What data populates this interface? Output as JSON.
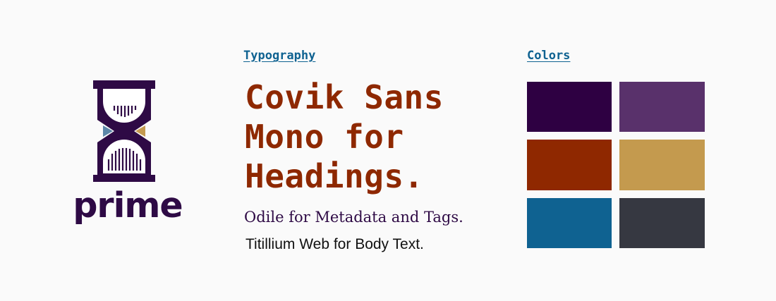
{
  "logo": {
    "wordmark": "prime",
    "colors": {
      "frame": "#2e0a45",
      "glass": "#ffffff",
      "left_accent": "#5c87a8",
      "right_accent": "#c49a50"
    }
  },
  "typography": {
    "title": "Typography",
    "title_color": "#0f6291",
    "heading_lines": [
      "Covik Sans",
      "Mono for",
      "Headings."
    ],
    "heading_color": "#8e2800",
    "metadata": "Odile for Metadata and Tags.",
    "metadata_color": "#2e0a45",
    "body": "Titillium Web for Body Text.",
    "body_color": "#111111"
  },
  "colors": {
    "title": "Colors",
    "title_color": "#0f6291",
    "swatches": [
      "#2e0042",
      "#59316b",
      "#8f2800",
      "#c49a4e",
      "#0f6291",
      "#363841"
    ]
  }
}
